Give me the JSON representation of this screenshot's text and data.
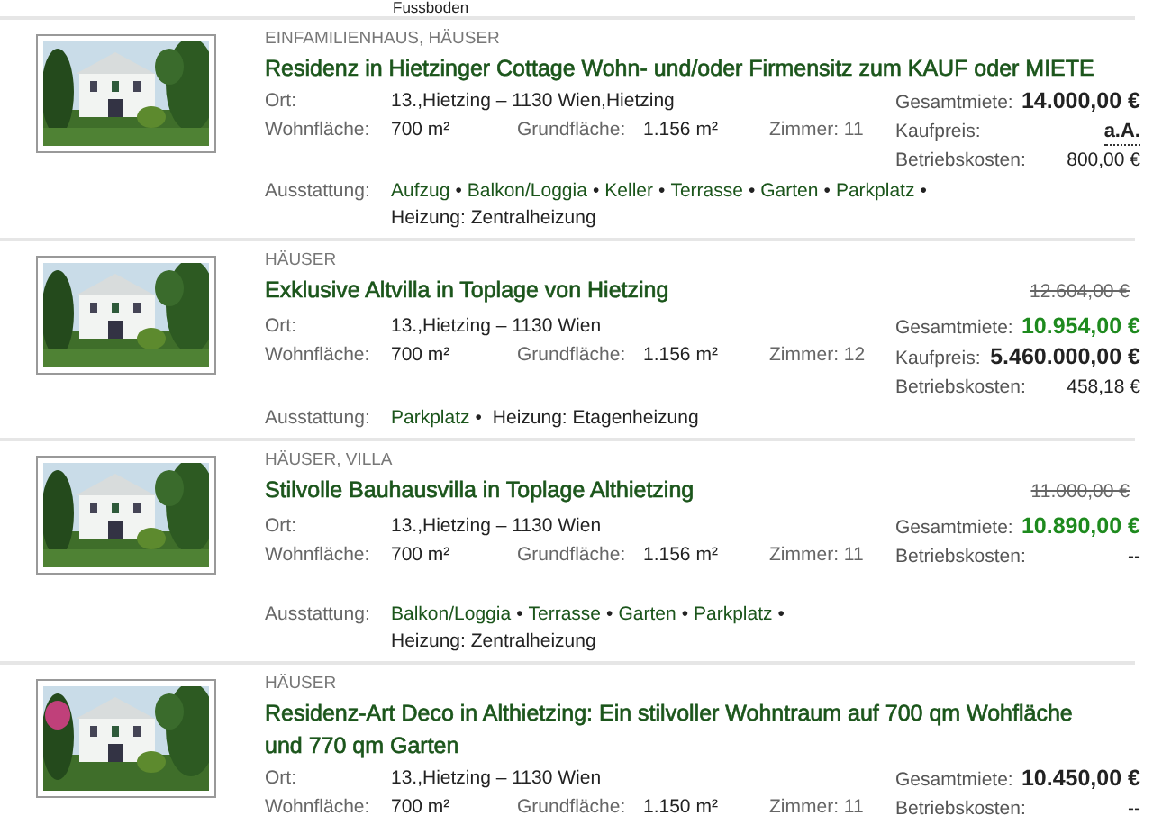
{
  "top_fragment": "Fussboden",
  "listings": [
    {
      "category": "EINFAMILIENHAUS, HÄUSER",
      "title": "Residenz in Hietzinger Cottage Wohn- und/oder Firmensitz zum KAUF oder MIETE",
      "location_label": "Ort:",
      "location": "13.,Hietzing – 1130 Wien,Hietzing",
      "living_label": "Wohnfläche:",
      "living": "700 m²",
      "plot_label": "Grundfläche:",
      "plot": "1.156 m²",
      "rooms": "Zimmer: 11",
      "prices": [
        {
          "label": "Gesamtmiete:",
          "value": "14.000,00 €",
          "kind": "amount"
        },
        {
          "label": "Kaufpreis:",
          "value": "a.A.",
          "kind": "request"
        },
        {
          "label": "Betriebskosten:",
          "value": "800,00 €",
          "kind": "plain"
        }
      ],
      "features_label": "Ausstattung:",
      "separator": "•",
      "features": [
        "Aufzug",
        "Balkon/Loggia",
        "Keller",
        "Terrasse",
        "Garten",
        "Parkplatz"
      ],
      "heating": "Heizung: Zentralheizung"
    },
    {
      "category": "HÄUSER",
      "title": "Exklusive Altvilla in Toplage von Hietzing",
      "old_price": "12.604,00 €",
      "location_label": "Ort:",
      "location": "13.,Hietzing – 1130 Wien",
      "living_label": "Wohnfläche:",
      "living": "700 m²",
      "plot_label": "Grundfläche:",
      "plot": "1.156 m²",
      "rooms": "Zimmer: 12",
      "prices": [
        {
          "label": "Gesamtmiete:",
          "value": "10.954,00 €",
          "kind": "reduced"
        },
        {
          "label": "Kaufpreis:",
          "value": "5.460.000,00 €",
          "kind": "amount"
        },
        {
          "label": "Betriebskosten:",
          "value": "458,18 €",
          "kind": "plain"
        }
      ],
      "features_label": "Ausstattung:",
      "separator": "•",
      "features": [
        "Parkplatz"
      ],
      "heating": "Heizung: Etagenheizung"
    },
    {
      "category": "HÄUSER, VILLA",
      "title": "Stilvolle Bauhausvilla in Toplage Althietzing",
      "old_price": "11.000,00 €",
      "location_label": "Ort:",
      "location": "13.,Hietzing – 1130 Wien",
      "living_label": "Wohnfläche:",
      "living": "700 m²",
      "plot_label": "Grundfläche:",
      "plot": "1.156 m²",
      "rooms": "Zimmer: 11",
      "prices": [
        {
          "label": "Gesamtmiete:",
          "value": "10.890,00 €",
          "kind": "reduced"
        },
        {
          "label": "Betriebskosten:",
          "value": "--",
          "kind": "plain"
        }
      ],
      "features_label": "Ausstattung:",
      "separator": "•",
      "features": [
        "Balkon/Loggia",
        "Terrasse",
        "Garten",
        "Parkplatz"
      ],
      "heating": "Heizung: Zentralheizung"
    },
    {
      "category": "HÄUSER",
      "title": "Residenz-Art Deco in Althietzing: Ein stilvoller Wohntraum auf 700 qm Wohfläche und 770 qm Garten",
      "location_label": "Ort:",
      "location": "13.,Hietzing – 1130 Wien",
      "living_label": "Wohnfläche:",
      "living": "700 m²",
      "plot_label": "Grundfläche:",
      "plot": "1.150 m²",
      "rooms": "Zimmer: 11",
      "prices": [
        {
          "label": "Gesamtmiete:",
          "value": "10.450,00 €",
          "kind": "amount"
        },
        {
          "label": "Betriebskosten:",
          "value": "--",
          "kind": "plain"
        }
      ]
    }
  ]
}
